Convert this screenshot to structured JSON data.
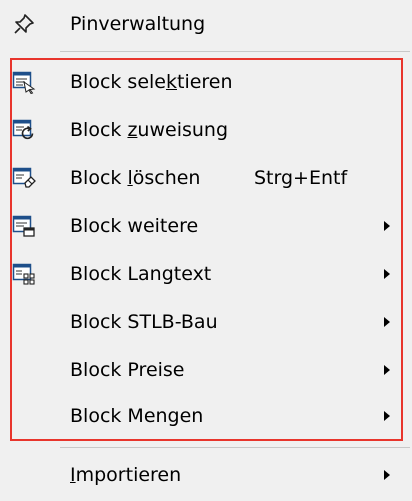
{
  "menu": {
    "pin": {
      "label": "Pinverwaltung",
      "icon": "pin-icon"
    },
    "items": [
      {
        "pre": "Block sele",
        "u": "k",
        "post": "tieren",
        "shortcut": "",
        "submenu": false,
        "icon": "block-select-icon"
      },
      {
        "pre": "Block ",
        "u": "z",
        "post": "uweisung",
        "shortcut": "",
        "submenu": false,
        "icon": "block-assign-icon"
      },
      {
        "pre": "Block ",
        "u": "l",
        "post": "öschen",
        "shortcut": "Strg+Entf",
        "submenu": false,
        "icon": "block-delete-icon"
      },
      {
        "pre": "Block weitere",
        "u": "",
        "post": "",
        "shortcut": "",
        "submenu": true,
        "icon": "block-more-icon"
      },
      {
        "pre": "Block Langtext",
        "u": "",
        "post": "",
        "shortcut": "",
        "submenu": true,
        "icon": "block-longtext-icon"
      },
      {
        "pre": "Block STLB-Bau",
        "u": "",
        "post": "",
        "shortcut": "",
        "submenu": true,
        "icon": ""
      },
      {
        "pre": "Block Preise",
        "u": "",
        "post": "",
        "shortcut": "",
        "submenu": true,
        "icon": ""
      },
      {
        "pre": "Block Mengen",
        "u": "",
        "post": "",
        "shortcut": "",
        "submenu": true,
        "icon": ""
      }
    ],
    "import": {
      "u": "I",
      "post": "mportieren",
      "submenu": true
    }
  },
  "colors": {
    "background": "#f0f0f0",
    "highlight_border": "#e8352c"
  }
}
